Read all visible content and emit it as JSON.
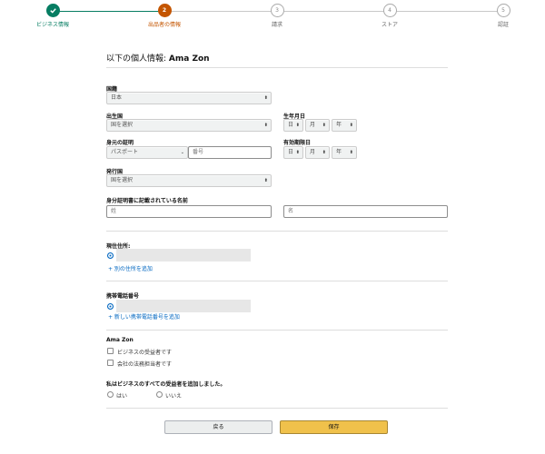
{
  "stepper": {
    "steps": [
      {
        "number": "",
        "label": "ビジネス情報",
        "state": "done"
      },
      {
        "number": "2",
        "label": "出品者の情報",
        "state": "current"
      },
      {
        "number": "3",
        "label": "請求",
        "state": "upcoming"
      },
      {
        "number": "4",
        "label": "ストア",
        "state": "upcoming"
      },
      {
        "number": "5",
        "label": "認証",
        "state": "upcoming"
      }
    ]
  },
  "header": {
    "title_prefix": "以下の個人情報: ",
    "title_name": "Ama Zon"
  },
  "form": {
    "nationality": {
      "label": "国籍",
      "value": "日本"
    },
    "birth_country": {
      "label": "出生国",
      "value": "国を選択"
    },
    "birth_date": {
      "label": "生年月日",
      "day": "日",
      "month": "月",
      "year": "年"
    },
    "id_proof": {
      "label": "身元の証明",
      "type_value": "パスポート",
      "number_placeholder": "番号"
    },
    "expiry": {
      "label": "有効期限日",
      "day": "日",
      "month": "月",
      "year": "年"
    },
    "issuing_country": {
      "label": "発行国",
      "value": "国を選択"
    },
    "id_name": {
      "label": "身分証明書に記載されている名前",
      "last_placeholder": "姓",
      "first_placeholder": "名"
    },
    "address": {
      "label": "現住住所:",
      "add_link": "+ 別の住所を追加"
    },
    "phone": {
      "label": "携帯電話番号",
      "add_link": "+ 新しい携帯電話番号を追加"
    },
    "owner": {
      "name": "Ama Zon",
      "options": [
        "ビジネスの受益者です",
        "会社の法務担当者です"
      ]
    },
    "all_added": {
      "question": "私はビジネスのすべての受益者を追加しました。",
      "yes": "はい",
      "no": "いいえ"
    }
  },
  "buttons": {
    "back": "戻る",
    "save": "保存"
  }
}
